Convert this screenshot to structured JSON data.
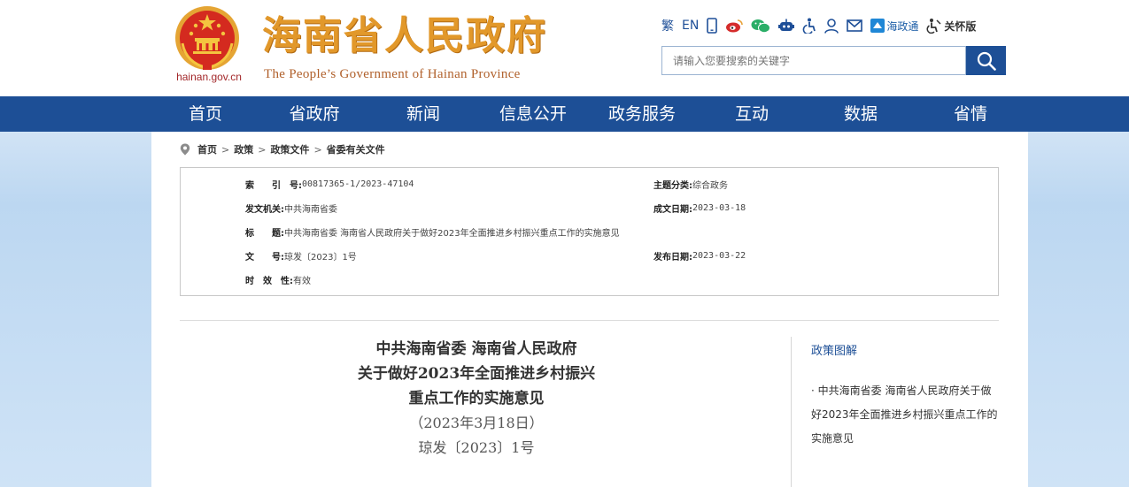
{
  "header": {
    "site_url": "hainan.gov.cn",
    "title": "海南省人民政府",
    "subtitle": "The People’s Government  of Hainan Province",
    "toolbar": {
      "traditional": "繁",
      "english": "EN",
      "hainantong": "海政通",
      "care_mode": "关怀版"
    },
    "search": {
      "placeholder": "请输入您要搜索的关键字"
    }
  },
  "nav": {
    "items": [
      "首页",
      "省政府",
      "新闻",
      "信息公开",
      "政务服务",
      "互动",
      "数据",
      "省情"
    ]
  },
  "breadcrumb": [
    "首页",
    "政策",
    "政策文件",
    "省委有关文件"
  ],
  "meta": {
    "index_label": "索　　引　号:",
    "index_value": "00817365-1/2023-47104",
    "category_label": "主题分类:",
    "category_value": "综合政务",
    "issuer_label": "发文机关:",
    "issuer_value": "中共海南省委",
    "created_label": "成文日期:",
    "created_value": "2023-03-18",
    "title_label": "标　　题:",
    "title_value": "中共海南省委 海南省人民政府关于做好2023年全面推进乡村振兴重点工作的实施意见",
    "docno_label": "文　　号:",
    "docno_value": "琼发〔2023〕1号",
    "published_label": "发布日期:",
    "published_value": "2023-03-22",
    "validity_label": "时　效　性:",
    "validity_value": "有效"
  },
  "document": {
    "title_line1": "中共海南省委  海南省人民政府",
    "title_line2": "关于做好2023年全面推进乡村振兴",
    "title_line3": "重点工作的实施意见",
    "date": "（2023年3月18日）",
    "number": "琼发〔2023〕1号"
  },
  "sidebar": {
    "heading": "政策图解",
    "link": "· 中共海南省委 海南省人民政府关于做好2023年全面推进乡村振兴重点工作的实施意见"
  },
  "colors": {
    "nav_blue": "#1d4f96",
    "title_orange": "#e2982a",
    "emblem_red": "#d42a1f"
  }
}
